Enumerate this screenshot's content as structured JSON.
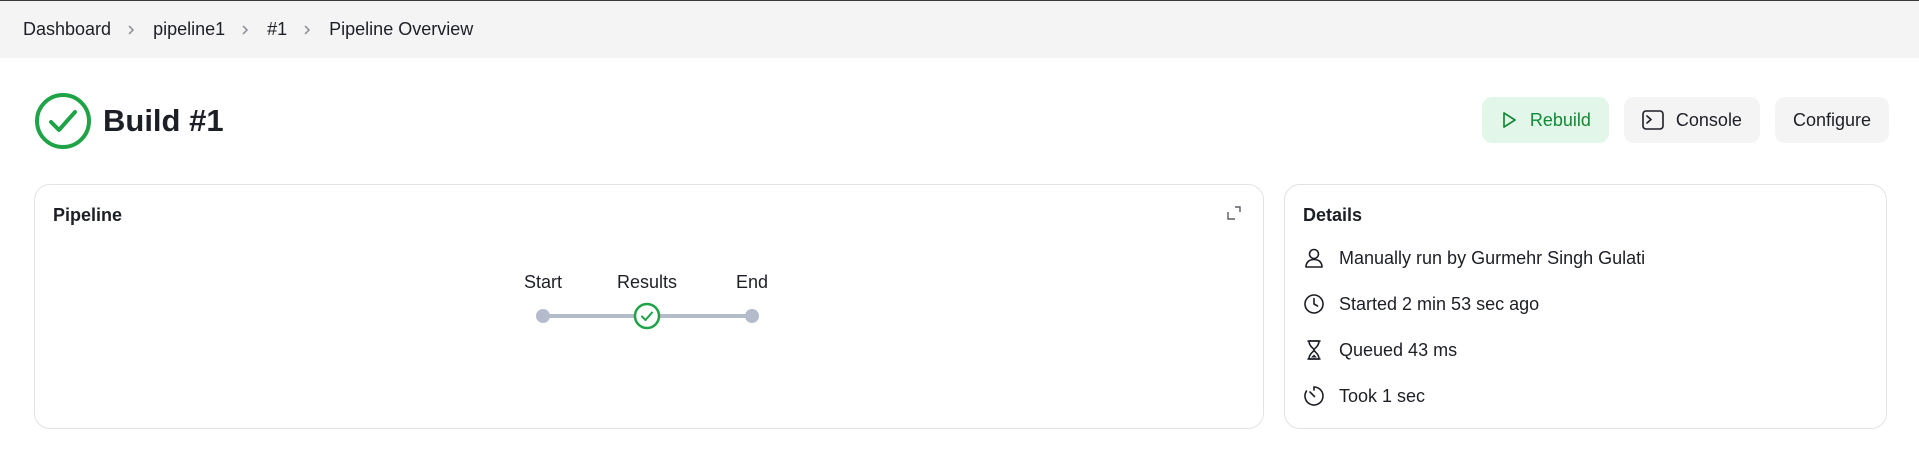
{
  "breadcrumb": {
    "items": [
      "Dashboard",
      "pipeline1",
      "#1",
      "Pipeline Overview"
    ]
  },
  "build": {
    "title": "Build #1",
    "status": "success",
    "status_color": "#1ea446"
  },
  "actions": {
    "rebuild": "Rebuild",
    "console": "Console",
    "configure": "Configure"
  },
  "pipeline": {
    "title": "Pipeline",
    "stages": [
      {
        "label": "Start",
        "state": "none"
      },
      {
        "label": "Results",
        "state": "success"
      },
      {
        "label": "End",
        "state": "none"
      }
    ]
  },
  "details": {
    "title": "Details",
    "rows": [
      {
        "icon": "user-icon",
        "text": "Manually run by Gurmehr Singh Gulati"
      },
      {
        "icon": "clock-icon",
        "text": "Started 2 min 53 sec ago"
      },
      {
        "icon": "hourglass-icon",
        "text": "Queued 43 ms"
      },
      {
        "icon": "timer-icon",
        "text": "Took 1 sec"
      }
    ]
  },
  "colors": {
    "success": "#1ea446",
    "primary_button_bg": "#e2f6e9",
    "neutral_button_bg": "#f4f4f5",
    "graph_line": "#b4bccb"
  }
}
